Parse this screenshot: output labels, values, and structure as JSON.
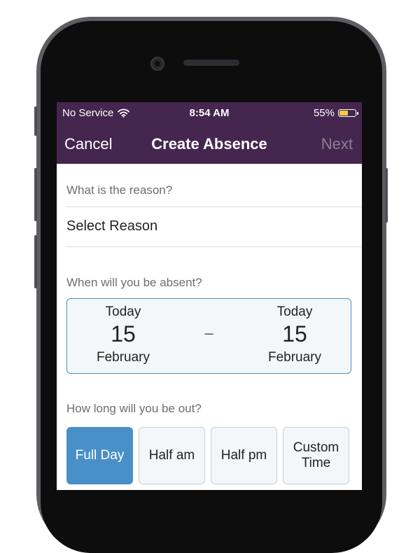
{
  "status_bar": {
    "carrier": "No Service",
    "time": "8:54 AM",
    "battery_percent": "55%",
    "battery_level": 0.55,
    "battery_color": "#f7c948"
  },
  "nav": {
    "cancel_label": "Cancel",
    "title": "Create Absence",
    "next_label": "Next"
  },
  "reason": {
    "label": "What is the reason?",
    "value": "Select Reason"
  },
  "dates": {
    "label": "When will you be absent?",
    "separator": "–",
    "start": {
      "day_label": "Today",
      "day_number": "15",
      "month": "February"
    },
    "end": {
      "day_label": "Today",
      "day_number": "15",
      "month": "February"
    }
  },
  "duration": {
    "label": "How long will you be out?",
    "options": [
      {
        "label": "Full Day",
        "selected": true
      },
      {
        "label": "Half am",
        "selected": false
      },
      {
        "label": "Half pm",
        "selected": false
      },
      {
        "label": "Custom\nTime",
        "selected": false
      }
    ]
  },
  "colors": {
    "brand_purple": "#45264f",
    "accent_blue": "#4a90c8"
  },
  "icons": {
    "wifi": "wifi-icon",
    "battery": "battery-icon",
    "camera": "front-camera-icon"
  }
}
